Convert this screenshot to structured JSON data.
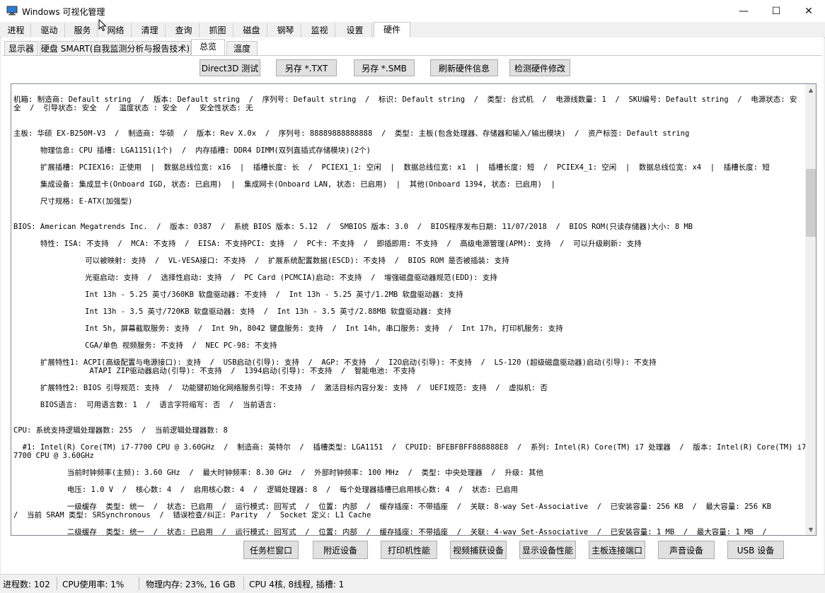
{
  "window": {
    "title": "Windows 可视化管理",
    "minimize_glyph": "—",
    "maximize_glyph": "☐",
    "close_glyph": "✕"
  },
  "main_tabs": [
    "进程",
    "驱动",
    "服务",
    "网络",
    "清理",
    "查询",
    "抓图",
    "磁盘",
    "钢琴",
    "监视",
    "设置",
    "硬件"
  ],
  "main_tab_active": "硬件",
  "sub_tabs": [
    "显示器",
    "硬盘 SMART(自我监测分析与报告技术)",
    "总览",
    "温度"
  ],
  "sub_tab_active": "总览",
  "top_buttons": [
    "Direct3D 测试",
    "另存 *.TXT",
    "另存 *.SMB",
    "刷新硬件信息",
    "检测硬件修改"
  ],
  "bottom_buttons": [
    "任务栏窗口",
    "附近设备",
    "打印机性能",
    "视频捕获设备",
    "显示设备性能",
    "主板连接端口",
    "声音设备",
    "USB 设备"
  ],
  "content_lines": [
    "机箱: 制造商: Default string  /  版本: Default string  /  序列号: Default string  /  标识: Default string  /  类型: 台式机  /  电源线数量: 1  /  SKU编号: Default string  /  电源状态: 安",
    "全  /  引导状态: 安全  /  温度状态 : 安全  /  安全性状态: 无",
    "主板: 华硕 EX-B250M-V3  /  制造商: 华硕  /  版本: Rev X.0x  /  序列号: 88889888888888  /  类型: 主板(包含处理器、存储器和输入/输出模块)  /  资产标签: Default string",
    "      物理信息: CPU 插槽: LGA1151(1个)  /  内存插槽: DDR4 DIMM(双列直插式存储模块)(2个)",
    "      扩展插槽: PCIEX16: 正使用  |  数据总线位宽: x16  |  插槽长度: 长  /  PCIEX1_1: 空闲  |  数据总线位宽: x1  |  插槽长度: 短  /  PCIEX4_1: 空闲  |  数据总线位宽: x4  |  插槽长度: 短",
    "      集成设备: 集成显卡(Onboard IGD, 状态: 已启用)  |  集成网卡(Onboard LAN, 状态: 已启用)  |  其他(Onboard 1394, 状态: 已启用)  |",
    "      尺寸规格: E-ATX(加强型)",
    "BIOS: American Megatrends Inc.  /  版本: 0387  /  系统 BIOS 版本: 5.12  /  SMBIOS 版本: 3.0  /  BIOS程序发布日期: 11/07/2018  /  BIOS ROM(只读存储器)大小: 8 MB",
    "      特性: ISA: 不支持  /  MCA: 不支持  /  EISA: 不支持PCI: 支持  /  PC卡: 不支持  /  即插即用: 不支持  /  高级电源管理(APM): 支持  /  可以升级刷新: 支持",
    "                可以被映射: 支持  /  VL-VESA接口: 不支持  /  扩展系统配置数据(ESCD): 不支持  /  BIOS ROM 是否被插装: 支持",
    "                光驱启动: 支持  /  选择性启动: 支持  /  PC Card (PCMCIA)启动: 不支持  /  增强磁盘驱动器规范(EDD): 支持",
    "                Int 13h - 5.25 英寸/360KB 软盘驱动器: 不支持  /  Int 13h - 5.25 英寸/1.2MB 软盘驱动器: 支持",
    "                Int 13h - 3.5 英寸/720KB 软盘驱动器: 支持  /  Int 13h - 3.5 英寸/2.88MB 软盘驱动器: 支持",
    "                Int 5h, 屏幕截取服务: 支持  /  Int 9h, 8042 键盘服务: 支持  /  Int 14h, 串口服务: 支持  /  Int 17h, 打印机服务: 支持",
    "                CGA/单色 视频服务: 不支持  /  NEC PC-98: 不支持",
    "      扩展特性1: ACPI(高级配置与电源接口): 支持  /  USB启动(引导): 支持  /  AGP: 不支持  /  I2O启动(引导): 不支持  /  LS-120 (超级磁盘驱动器)启动(引导): 不支持",
    "                 ATAPI ZIP驱动器启动(引导): 不支持  /  1394启动(引导): 不支持  /  智能电池: 不支持",
    "      扩展特性2: BIOS 引导规范: 支持  /  功能键初始化网络服务引导: 不支持  /  激活目标内容分发: 支持  /  UEFI规范: 支持  /  虚拟机: 否",
    "      BIOS语言:  可用语言数: 1  /  语言字符缩写: 否  /  当前语言:",
    "CPU: 系统支持逻辑处理器数: 255  /  当前逻辑处理器数: 8",
    "  #1: Intel(R) Core(TM) i7-7700 CPU @ 3.60GHz  /  制造商: 英特尔  /  插槽类型: LGA1151  /  CPUID: BFEBFBFF888888E8  /  系列: Intel(R) Core(TM) i7 处理器  /  版本: Intel(R) Core(TM) i7-",
    "7700 CPU @ 3.60GHz",
    "            当前时钟频率(主频): 3.60 GHz  /  最大时钟频率: 8.30 GHz  /  外部时钟频率: 100 MHz  /  类型: 中央处理器  /  升级: 其他",
    "            电压: 1.0 V  /  核心数: 4  /  启用核心数: 4  /  逻辑处理器: 8  /  每个处理器插槽已启用核心数: 4  /  状态: 已启用",
    "            一级缓存  类型: 统一  /  状态: 已启用  /  运行模式: 回写式  /  位置: 内部  /  缓存插座: 不带插座  /  关联: 8-way Set-Associative  /  已安装容量: 256 KB  /  最大容量: 256 KB",
    "/  当前 SRAM 类型: SRSynchronous  /  错误检查/纠正: Parity  /  Socket 定义: L1 Cache",
    "            二级缓存  类型: 统一  /  状态: 已启用  /  运行模式: 回写式  /  位置: 内部  /  缓存插座: 不带插座  /  关联: 4-way Set-Associative  /  已安装容量: 1 MB  /  最大容量: 1 MB  /"
  ],
  "status_bar": {
    "processes": "进程数: 102",
    "cpu_usage": "CPU使用率: 1%",
    "memory": "物理内存: 23%, 16 GB",
    "cpu_info": "CPU 4核, 8线程, 插槽: 1"
  }
}
